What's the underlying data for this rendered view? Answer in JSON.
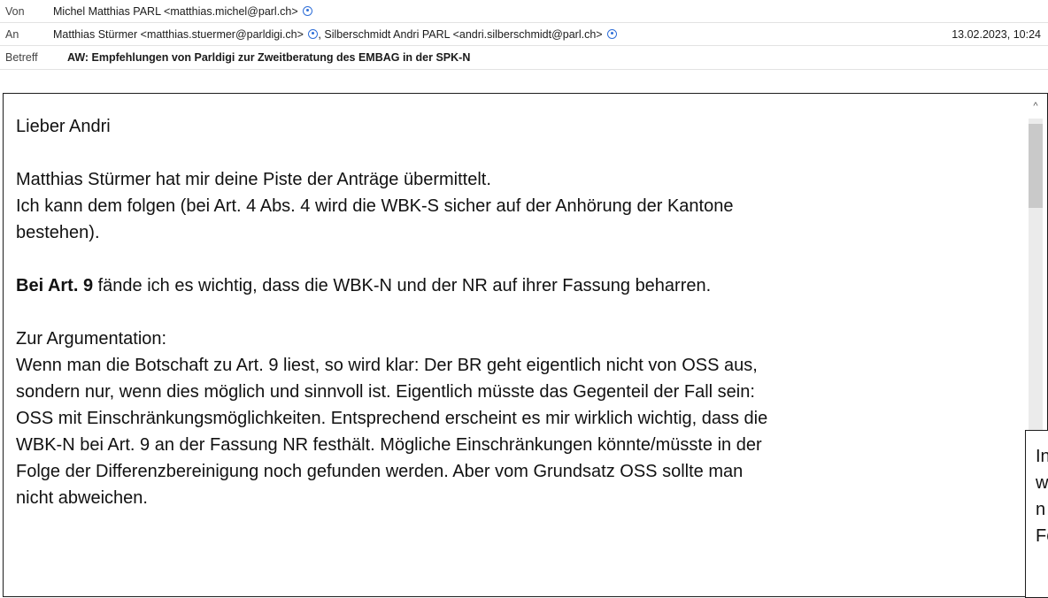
{
  "header": {
    "from_label": "Von",
    "from_value": "Michel Matthias PARL <matthias.michel@parl.ch>",
    "to_label": "An",
    "to_value_1": "Matthias Stürmer <matthias.stuermer@parldigi.ch>",
    "to_value_2": ", Silberschmidt Andri PARL <andri.silberschmidt@parl.ch>",
    "date": "13.02.2023, 10:24",
    "subject_label": "Betreff",
    "subject_value": "AW: Empfehlungen von Parldigi zur Zweitberatung des EMBAG in der SPK-N"
  },
  "body": {
    "greeting": "Lieber Andri",
    "p1_line1": "Matthias Stürmer hat mir deine Piste der Anträge übermittelt.",
    "p1_line2": "Ich kann dem folgen (bei Art. 4 Abs. 4 wird die WBK-S sicher auf der Anhörung der Kantone",
    "p1_line3": "bestehen).",
    "p2_bold": "Bei Art. 9",
    "p2_rest": " fände ich es wichtig, dass die WBK-N und der NR auf ihrer Fassung beharren.",
    "p3_line1": "Zur Argumentation:",
    "p3_line2": "Wenn man die Botschaft zu Art. 9 liest, so wird klar: Der BR geht eigentlich nicht von OSS aus,",
    "p3_line3": "sondern nur, wenn dies möglich und sinnvoll ist. Eigentlich müsste das Gegenteil der  Fall sein:",
    "p3_line4": "OSS mit Einschränkungsmöglichkeiten. Entsprechend erscheint es mir wirklich wichtig, dass die",
    "p3_line5": "WBK-N bei Art. 9 an der Fassung NR festhält. Mögliche Einschränkungen könnte/müsste in der",
    "p3_line6": "Folge der Differenzbereinigung noch gefunden werden. Aber vom Grundsatz OSS sollte man",
    "p3_line7": "nicht abweichen."
  },
  "overlay": {
    "line1": "In",
    "line2": "w",
    "line3": "n",
    "line4": "Fo"
  },
  "scrollbar": {
    "up_glyph": "^"
  }
}
